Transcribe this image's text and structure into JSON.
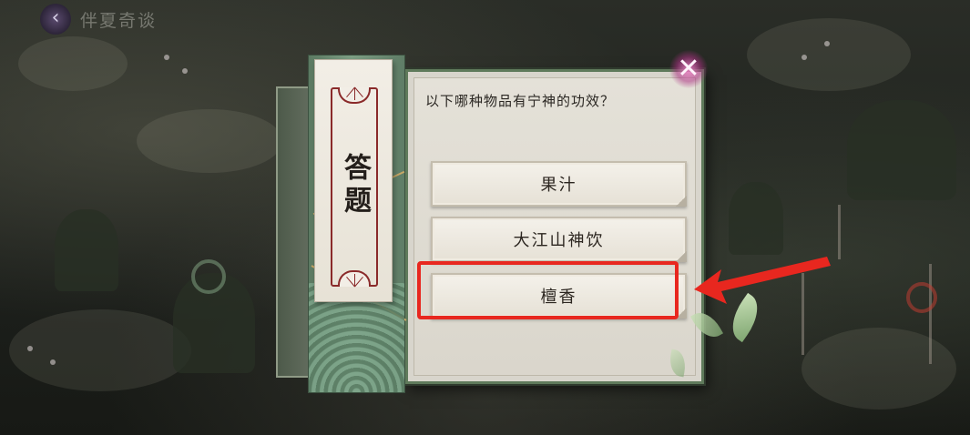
{
  "header": {
    "back_icon": "chevron-left-icon",
    "title": "伴夏奇谈"
  },
  "panel": {
    "banner_title": "答题",
    "question": "以下哪种物品有宁神的功效？",
    "options": [
      {
        "label": "果汁",
        "highlighted": false
      },
      {
        "label": "大江山神饮",
        "highlighted": false
      },
      {
        "label": "檀香",
        "highlighted": true
      }
    ],
    "close_icon": "close-icon"
  },
  "annotation": {
    "highlight_color": "#e8271f",
    "pointer_icon": "arrow-left-icon"
  }
}
